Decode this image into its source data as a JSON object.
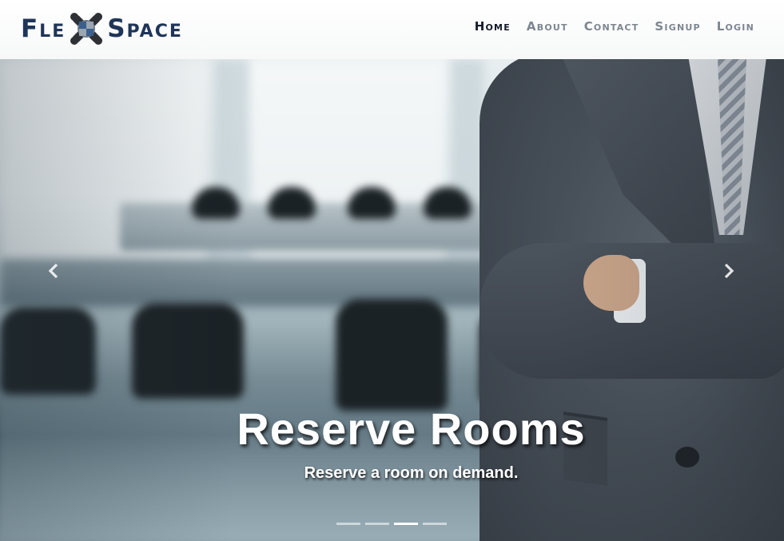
{
  "brand": {
    "part1": "Fle",
    "part2": "Space",
    "logo_icon": "puzzle-x-icon",
    "color": "#1f3558"
  },
  "nav": {
    "items": [
      {
        "label": "Home",
        "active": true
      },
      {
        "label": "About",
        "active": false
      },
      {
        "label": "Contact",
        "active": false
      },
      {
        "label": "Signup",
        "active": false
      },
      {
        "label": "Login",
        "active": false
      }
    ],
    "active_color": "#111a26",
    "inactive_color": "#7d8690"
  },
  "carousel": {
    "title": "Reserve Rooms",
    "subtitle": "Reserve a room on demand.",
    "prev_icon": "chevron-left-icon",
    "next_icon": "chevron-right-icon",
    "slide_count": 4,
    "active_slide": 3
  }
}
